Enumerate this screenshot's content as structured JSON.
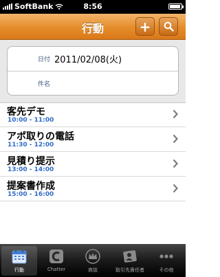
{
  "status_bar": {
    "carrier": "SoftBank",
    "time": "8:56"
  },
  "nav": {
    "title": "行動",
    "add_icon": "plus-icon",
    "search_icon": "search-icon"
  },
  "form": {
    "date_label": "日付",
    "date_value": "2011/02/08(火)",
    "subject_label": "件名",
    "subject_value": ""
  },
  "events": [
    {
      "title": "客先デモ",
      "time": "10:00 - 11:00"
    },
    {
      "title": "アポ取りの電話",
      "time": "11:30 - 12:00"
    },
    {
      "title": "見積り提示",
      "time": "13:00 - 14:00"
    },
    {
      "title": "提案書作成",
      "time": "15:00 - 16:00"
    }
  ],
  "tabs": [
    {
      "label": "行動",
      "icon": "calendar-icon",
      "selected": true
    },
    {
      "label": "Chatter",
      "icon": "chatter-icon",
      "selected": false
    },
    {
      "label": "商談",
      "icon": "crown-icon",
      "selected": false
    },
    {
      "label": "取引先責任者",
      "icon": "contact-card-icon",
      "selected": false
    },
    {
      "label": "その他",
      "icon": "more-dots-icon",
      "selected": false
    }
  ],
  "colors": {
    "nav_orange": "#e58d2a",
    "time_blue": "#2f6bc7",
    "label_blue": "#3f5a7a"
  }
}
